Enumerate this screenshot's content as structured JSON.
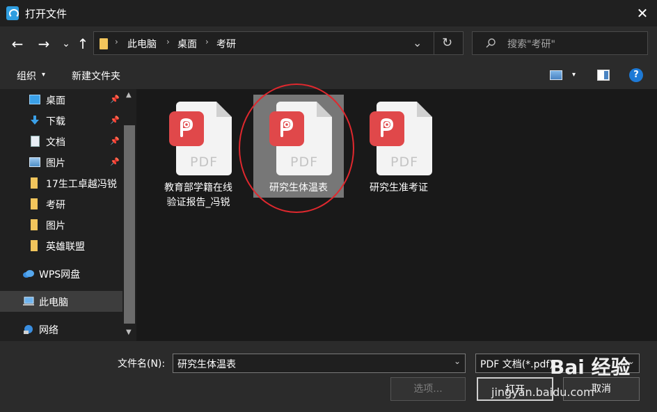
{
  "window": {
    "title": "打开文件",
    "close_glyph": "✕"
  },
  "nav": {
    "back_glyph": "←",
    "forward_glyph": "→",
    "recent_glyph": "⌄",
    "up_glyph": "↑",
    "breadcrumbs": [
      "此电脑",
      "桌面",
      "考研"
    ],
    "sep_glyph": "›",
    "dropdown_glyph": "⌄",
    "refresh_glyph": "↻",
    "search_placeholder": "搜索\"考研\""
  },
  "toolbar": {
    "organize_label": "组织",
    "new_folder_label": "新建文件夹",
    "caret_glyph": "▾",
    "help_glyph": "?"
  },
  "sidebar": {
    "pin_glyph": "📌",
    "items": [
      {
        "label": "桌面",
        "icon": "desktop-icon",
        "pinned": true
      },
      {
        "label": "下载",
        "icon": "download-icon",
        "pinned": true
      },
      {
        "label": "文档",
        "icon": "document-icon",
        "pinned": true
      },
      {
        "label": "图片",
        "icon": "pictures-icon",
        "pinned": true
      },
      {
        "label": "17生工卓越冯锐",
        "icon": "folder-icon",
        "pinned": false
      },
      {
        "label": "考研",
        "icon": "folder-icon",
        "pinned": false
      },
      {
        "label": "图片",
        "icon": "folder-icon",
        "pinned": false
      },
      {
        "label": "英雄联盟",
        "icon": "folder-icon",
        "pinned": false
      },
      {
        "label": "WPS网盘",
        "icon": "cloud-icon",
        "pinned": false
      },
      {
        "label": "此电脑",
        "icon": "computer-icon",
        "pinned": false,
        "selected": true
      },
      {
        "label": "网络",
        "icon": "network-icon",
        "pinned": false
      }
    ]
  },
  "files": [
    {
      "name_line1": "教育部学籍在线",
      "name_line2": "验证报告_冯锐",
      "icon_text": "PDF",
      "selected": false
    },
    {
      "name_line1": "研究生体温表",
      "name_line2": "",
      "icon_text": "PDF",
      "selected": true
    },
    {
      "name_line1": "研究生准考证",
      "name_line2": "",
      "icon_text": "PDF",
      "selected": false
    }
  ],
  "bottom": {
    "filename_label": "文件名(N):",
    "filename_value": "研究生体温表",
    "filetype_value": "PDF 文档(*.pdf)",
    "options_label": "选项...",
    "open_label": "打开",
    "cancel_label": "取消"
  },
  "watermark": {
    "text": "jingyan.baidu.com",
    "logo": "Bai 经验"
  },
  "colors": {
    "accent_red": "#e0484a",
    "highlight_circle": "#e0282e",
    "folder_yellow": "#f2c55c"
  }
}
